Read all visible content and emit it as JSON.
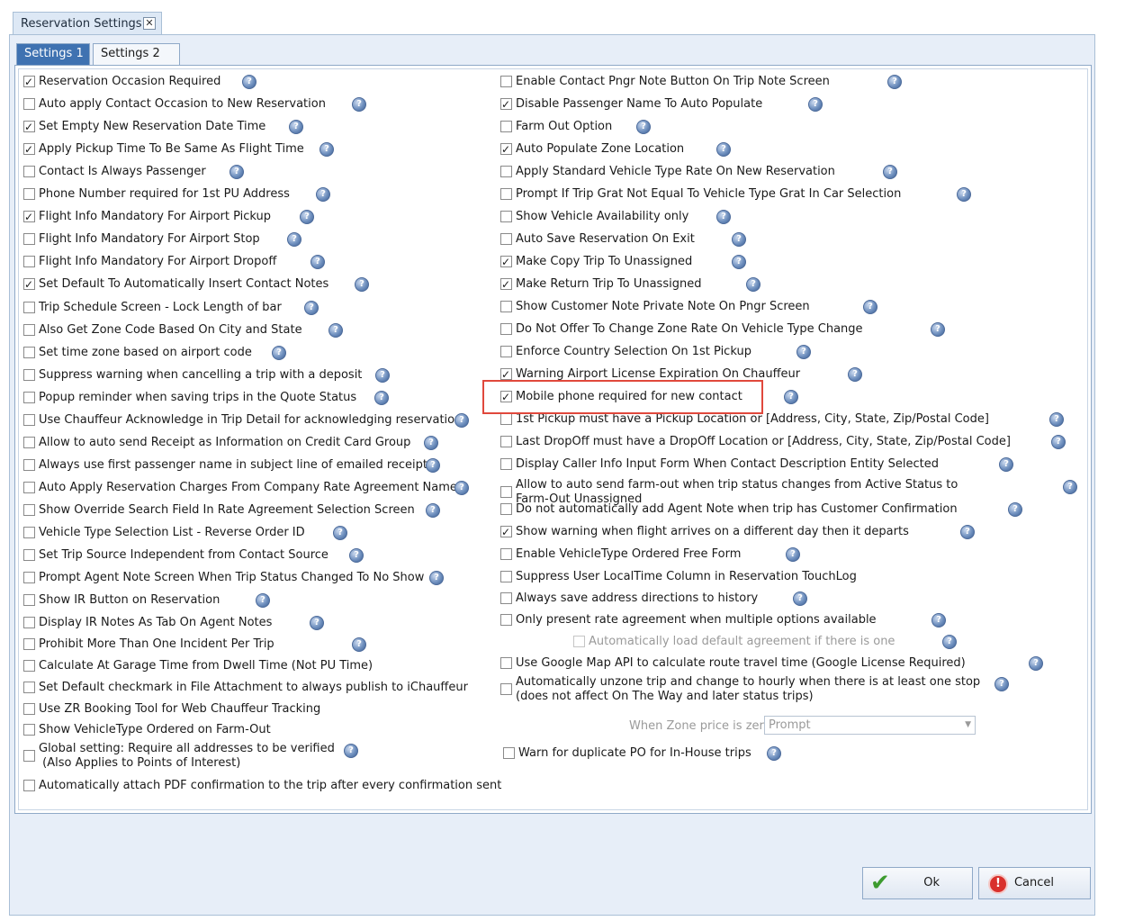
{
  "document_tab": {
    "title": "Reservation Settings",
    "close": "✕"
  },
  "tabs": [
    {
      "label": "Settings 1",
      "active": true
    },
    {
      "label": "Settings 2",
      "active": false
    }
  ],
  "help_glyph": "?",
  "left_column": [
    {
      "label": "Reservation Occasion Required",
      "checked": true
    },
    {
      "label": "Auto apply Contact Occasion to New Reservation",
      "checked": false
    },
    {
      "label": "Set Empty New Reservation Date Time",
      "checked": true
    },
    {
      "label": "Apply Pickup Time To Be Same As Flight Time",
      "checked": true
    },
    {
      "label": "Contact Is Always Passenger",
      "checked": false
    },
    {
      "label": "Phone Number required for 1st PU Address",
      "checked": false
    },
    {
      "label": "Flight Info Mandatory For Airport Pickup",
      "checked": true
    },
    {
      "label": "Flight Info Mandatory For Airport Stop",
      "checked": false
    },
    {
      "label": "Flight Info Mandatory For Airport Dropoff",
      "checked": false
    },
    {
      "label": "Set Default To Automatically Insert Contact Notes",
      "checked": true
    },
    {
      "label": "Trip Schedule Screen - Lock Length of bar",
      "checked": false
    },
    {
      "label": "Also Get Zone Code Based On City and State",
      "checked": false
    },
    {
      "label": "Set time zone based on airport code",
      "checked": false
    },
    {
      "label": "Suppress warning when cancelling a trip with a deposit",
      "checked": false
    },
    {
      "label": "Popup reminder when saving trips in the Quote Status",
      "checked": false
    },
    {
      "label": "Use Chauffeur Acknowledge in Trip Detail for acknowledging reservation",
      "checked": false
    },
    {
      "label": "Allow to auto send Receipt as Information on Credit Card Group",
      "checked": false
    },
    {
      "label": "Always use first passenger name in subject line of emailed receipt",
      "checked": false
    },
    {
      "label": "Auto Apply Reservation Charges From Company Rate Agreement Name",
      "checked": false
    },
    {
      "label": "Show Override Search Field In Rate Agreement Selection Screen",
      "checked": false
    },
    {
      "label": "Vehicle Type Selection List - Reverse Order ID",
      "checked": false
    },
    {
      "label": "Set Trip Source Independent from Contact Source",
      "checked": false
    },
    {
      "label": "Prompt Agent Note Screen When Trip Status Changed To No Show",
      "checked": false
    },
    {
      "label": "Show IR Button on Reservation",
      "checked": false
    },
    {
      "label": "Display IR Notes As Tab On Agent Notes",
      "checked": false
    },
    {
      "label": "Prohibit More Than One Incident Per Trip",
      "checked": false
    },
    {
      "label": "Calculate At Garage Time from Dwell Time (Not PU Time)",
      "checked": false
    },
    {
      "label": "Set Default checkmark in File Attachment to always publish to iChauffeur",
      "checked": false
    },
    {
      "label": "Use ZR Booking Tool for Web Chauffeur Tracking",
      "checked": false
    },
    {
      "label": "Show VehicleType Ordered on Farm-Out",
      "checked": false
    },
    {
      "label": "Global setting: Require all addresses to be verified\n (Also Applies to Points of Interest)",
      "checked": false
    },
    {
      "label": "Automatically attach PDF confirmation to the trip after every confirmation sent",
      "checked": false
    }
  ],
  "right_column": [
    {
      "label": "Enable Contact Pngr Note Button On Trip Note Screen",
      "checked": false
    },
    {
      "label": "Disable Passenger Name To Auto Populate",
      "checked": true
    },
    {
      "label": "Farm Out Option",
      "checked": false
    },
    {
      "label": "Auto Populate Zone Location",
      "checked": true
    },
    {
      "label": "Apply Standard Vehicle Type Rate On New Reservation",
      "checked": false
    },
    {
      "label": "Prompt If Trip Grat Not Equal To Vehicle Type Grat In Car Selection",
      "checked": false
    },
    {
      "label": "Show Vehicle Availability only",
      "checked": false
    },
    {
      "label": "Auto Save Reservation On Exit",
      "checked": false
    },
    {
      "label": "Make Copy Trip To Unassigned",
      "checked": true
    },
    {
      "label": "Make Return Trip To Unassigned",
      "checked": true
    },
    {
      "label": "Show Customer Note Private Note On Pngr Screen",
      "checked": false
    },
    {
      "label": "Do Not Offer To Change Zone Rate On Vehicle Type Change",
      "checked": false
    },
    {
      "label": "Enforce Country Selection On 1st Pickup",
      "checked": false
    },
    {
      "label": "Warning Airport License Expiration On Chauffeur",
      "checked": true
    },
    {
      "label": "Mobile phone required for new contact",
      "checked": true
    },
    {
      "label": "1st Pickup must have a Pickup Location or [Address, City, State, Zip/Postal Code]",
      "checked": false
    },
    {
      "label": "Last DropOff must have a DropOff Location or [Address, City, State, Zip/Postal Code]",
      "checked": false
    },
    {
      "label": "Display Caller Info Input Form When Contact Description Entity Selected",
      "checked": false
    },
    {
      "label": "Allow to auto send farm-out when trip status changes from Active Status to Farm-Out Unassigned",
      "checked": false
    },
    {
      "label": "Do not automatically add Agent Note when trip has Customer Confirmation",
      "checked": false
    },
    {
      "label": "Show warning when flight arrives on a different day then it departs",
      "checked": true
    },
    {
      "label": "Enable VehicleType Ordered Free Form",
      "checked": false
    },
    {
      "label": "Suppress User LocalTime Column in Reservation TouchLog",
      "checked": false
    },
    {
      "label": "Always save address directions to history",
      "checked": false
    },
    {
      "label": "Only present rate agreement when multiple options available",
      "checked": false
    },
    {
      "label": "Automatically load default agreement if there is one",
      "checked": false,
      "disabled": true
    },
    {
      "label": "Use Google Map API to calculate route travel time (Google License Required)",
      "checked": false
    },
    {
      "label": "Automatically unzone trip and change to hourly when there is at least one stop (does not affect On The Way and later status trips)",
      "checked": false
    },
    {
      "label": "Warn for duplicate PO for In-House trips",
      "checked": false
    }
  ],
  "zone_price": {
    "label": "When Zone price is zero",
    "value": "Prompt"
  },
  "buttons": {
    "ok": "Ok",
    "cancel": "Cancel"
  }
}
